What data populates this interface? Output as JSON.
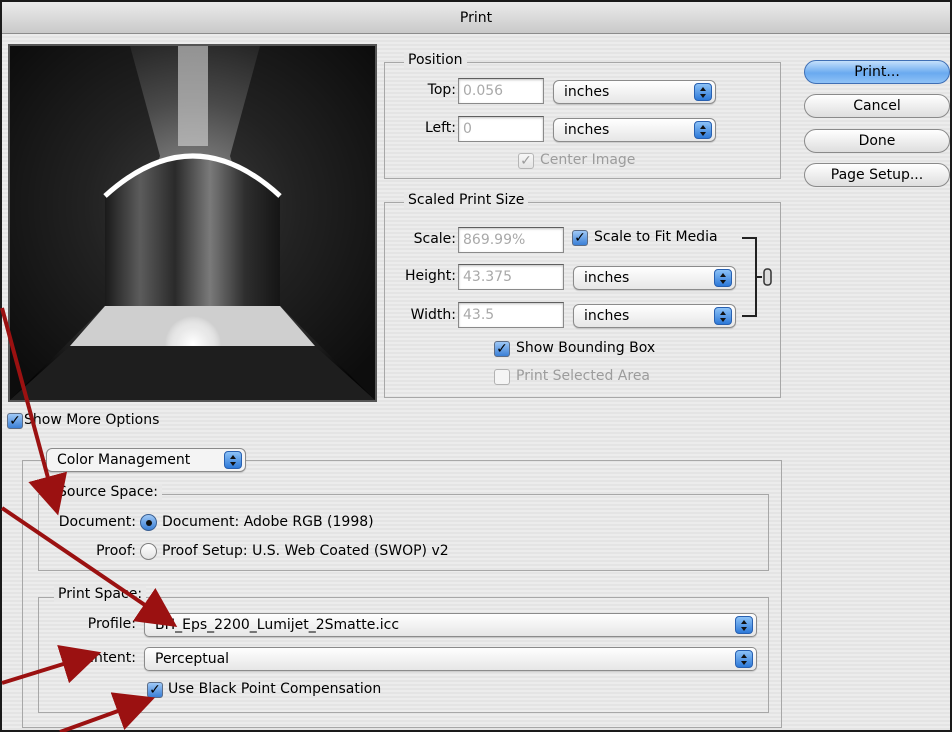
{
  "window": {
    "title": "Print"
  },
  "position": {
    "legend": "Position",
    "top_label": "Top:",
    "top_value": "0.056",
    "top_unit": "inches",
    "left_label": "Left:",
    "left_value": "0",
    "left_unit": "inches",
    "center_image_label": "Center Image"
  },
  "scaled": {
    "legend": "Scaled Print Size",
    "scale_label": "Scale:",
    "scale_value": "869.99%",
    "scale_to_fit_label": "Scale to Fit Media",
    "height_label": "Height:",
    "height_value": "43.375",
    "height_unit": "inches",
    "width_label": "Width:",
    "width_value": "43.5",
    "width_unit": "inches",
    "show_bbox_label": "Show Bounding Box",
    "print_selected_label": "Print Selected Area"
  },
  "buttons": {
    "print": "Print...",
    "cancel": "Cancel",
    "done": "Done",
    "page_setup": "Page Setup..."
  },
  "options": {
    "show_more_label": "Show More Options",
    "section_select": "Color Management"
  },
  "source_space": {
    "legend": "Source Space:",
    "document_label": "Document:",
    "document_option": "Document:  Adobe RGB (1998)",
    "proof_label": "Proof:",
    "proof_option": "Proof Setup:  U.S. Web Coated (SWOP) v2"
  },
  "print_space": {
    "legend": "Print Space:",
    "profile_label": "Profile:",
    "profile_value": "BH_Eps_2200_Lumijet_2Smatte.icc",
    "intent_label": "Intent:",
    "intent_value": "Perceptual",
    "bpc_label": "Use Black Point Compensation"
  },
  "colors": {
    "accent": "#3a7fd6",
    "annotation_arrow": "#9b1111"
  }
}
